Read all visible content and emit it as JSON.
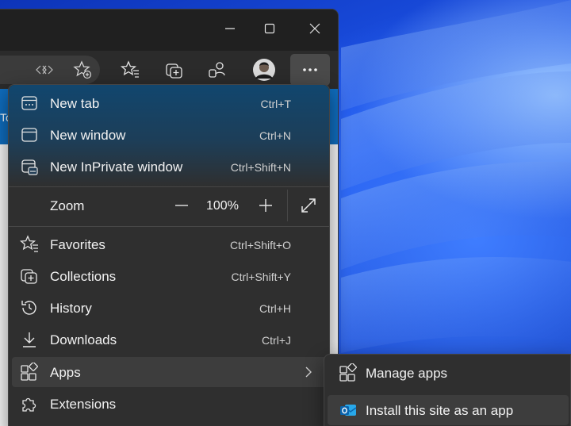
{
  "window": {
    "minimize_icon": "minimize-icon",
    "maximize_icon": "maximize-icon",
    "close_icon": "close-icon"
  },
  "toolbar": {
    "icons": [
      "split-screen-icon",
      "add-favorite-icon",
      "favorites-icon",
      "collections-icon",
      "profiles-icon",
      "avatar",
      "more-icon"
    ]
  },
  "page": {
    "strip_text": "To"
  },
  "menu": {
    "items_top": [
      {
        "label": "New tab",
        "shortcut": "Ctrl+T",
        "icon": "new-tab-icon"
      },
      {
        "label": "New window",
        "shortcut": "Ctrl+N",
        "icon": "new-window-icon"
      },
      {
        "label": "New InPrivate window",
        "shortcut": "Ctrl+Shift+N",
        "icon": "inprivate-icon"
      }
    ],
    "zoom": {
      "label": "Zoom",
      "value": "100%",
      "minus": "−",
      "plus": "+"
    },
    "items_bottom": [
      {
        "label": "Favorites",
        "shortcut": "Ctrl+Shift+O",
        "icon": "favorites-icon"
      },
      {
        "label": "Collections",
        "shortcut": "Ctrl+Shift+Y",
        "icon": "collections-icon"
      },
      {
        "label": "History",
        "shortcut": "Ctrl+H",
        "icon": "history-icon"
      },
      {
        "label": "Downloads",
        "shortcut": "Ctrl+J",
        "icon": "downloads-icon"
      },
      {
        "label": "Apps",
        "shortcut": "",
        "icon": "apps-icon"
      },
      {
        "label": "Extensions",
        "shortcut": "",
        "icon": "extensions-icon"
      }
    ]
  },
  "apps_submenu": {
    "items": [
      {
        "label": "Manage apps",
        "icon": "apps-icon"
      },
      {
        "label": "Install this site as an app",
        "icon": "outlook-icon"
      }
    ]
  },
  "colors": {
    "menu_bg": "#2f2f2f",
    "hover_bg": "#3d3d3d",
    "accent_blue": "#0f6cbd",
    "wallpaper_blue": "#1f58f0"
  }
}
